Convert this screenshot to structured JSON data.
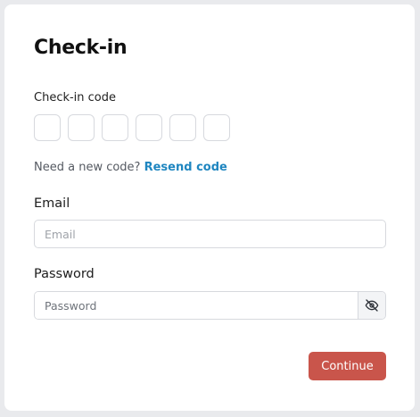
{
  "form": {
    "title": "Check-in",
    "code_label": "Check-in code",
    "code_digits": [
      "",
      "",
      "",
      "",
      "",
      ""
    ],
    "resend_prompt": "Need a new code?",
    "resend_link": "Resend code",
    "email": {
      "label": "Email",
      "placeholder": "Email",
      "value": ""
    },
    "password": {
      "label": "Password",
      "placeholder": "Password",
      "value": "",
      "toggle_icon": "eye-off-icon"
    },
    "submit_label": "Continue"
  },
  "colors": {
    "accent_link": "#1f86c0",
    "submit_button": "#c9554b",
    "page_background": "#e9eaed"
  }
}
